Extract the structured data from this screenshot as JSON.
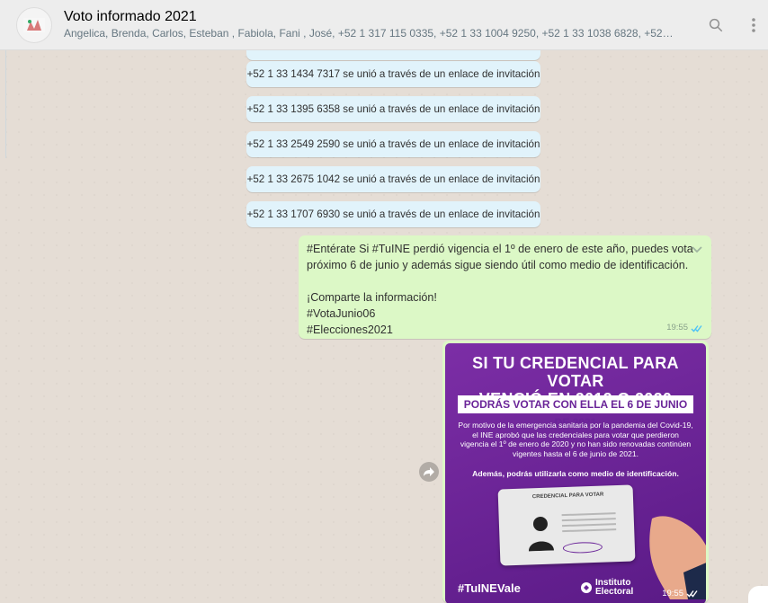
{
  "header": {
    "title": "Voto informado 2021",
    "participants": "Angelica, Brenda, Carlos, Esteban , Fabiola, Fani , José, +52 1 317 115 0335, +52 1 33 1004 9250, +52 1 33 1038 6828, +52 1 33 1061 5...",
    "icons": [
      "group-avatar",
      "search-icon",
      "menu-icon"
    ]
  },
  "system_messages": [
    {
      "text": "+52 1 33 1434 7317 se unió a través de un enlace de invitación"
    },
    {
      "text": "+52 1 33 1395 6358 se unió a través de un enlace de invitación"
    },
    {
      "text": "+52 1 33 2549 2590 se unió a través de un enlace de invitación"
    },
    {
      "text": "+52 1 33 2675 1042 se unió a través de un enlace de invitación"
    },
    {
      "text": "+52 1 33 1707 6930 se unió a través de un enlace de invitación"
    }
  ],
  "outgoing_message": {
    "line1": "#Entérate Si #TuINE perdió vigencia el 1º de enero de este año, puedes vota",
    "line2": "próximo 6 de junio y además sigue siendo útil como medio de identificación.",
    "line3": "¡Comparte la información!",
    "line4": "#VotaJunio06",
    "line5": "#Elecciones2021",
    "time": "19:55"
  },
  "image_message": {
    "heading_line1": "Si tu credencial para votar",
    "heading_line2": "venció en 2019 o 2020",
    "banner": "Podrás votar con ella el 6 de junio de 2021",
    "body": "Por motivo de la emergencia sanitaria por la pandemia del Covid-19, el INE aprobó que las credenciales para votar que perdieron vigencia el 1º de enero de 2020 y no han sido renovadas continúen vigentes hasta el 6 de junio de 2021.",
    "body2": "Además, podrás utilizarla como medio de identificación.",
    "card_title": "CREDENCIAL PARA VOTAR",
    "hashtag": "#TuINEVale",
    "logo_line1": "Instituto",
    "logo_line2": "Electoral",
    "time": "19:55"
  },
  "colors": {
    "header_bg": "#ededed",
    "chat_bg": "#e5ddd5",
    "system_bubble": "#e1f3fb",
    "outgoing_bubble": "#dcf8c6",
    "read_ticks": "#4fc3f7",
    "poster_purple": "#6a2498"
  }
}
